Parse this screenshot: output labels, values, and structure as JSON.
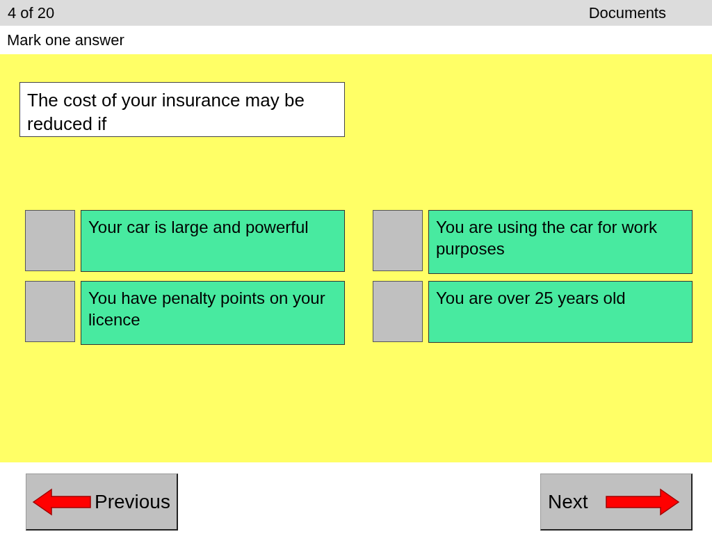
{
  "header": {
    "progress": "4 of 20",
    "category": "Documents"
  },
  "instruction": "Mark one answer",
  "question": "The cost of your insurance may be reduced if",
  "answers": [
    {
      "text": "Your car is large and powerful",
      "selected": false
    },
    {
      "text": "You are using the car for work purposes",
      "selected": false
    },
    {
      "text": "You have penalty points on your licence",
      "selected": false
    },
    {
      "text": "You are over 25 years old",
      "selected": false
    }
  ],
  "nav": {
    "previous": "Previous",
    "next": "Next"
  }
}
